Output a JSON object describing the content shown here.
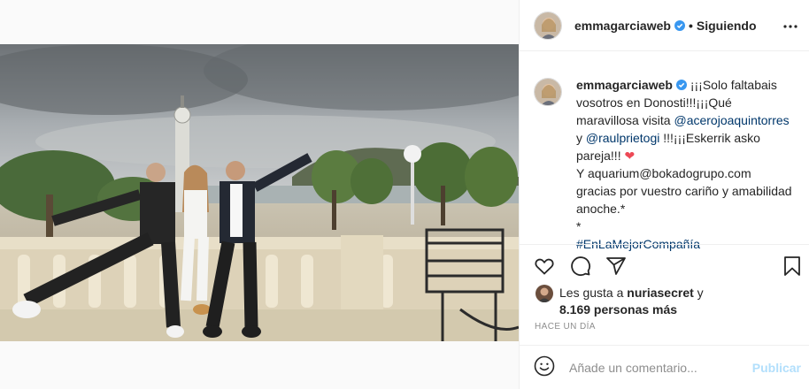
{
  "post": {
    "username": "emmagarciaweb",
    "separator": "•",
    "follow_status": "Siguiendo"
  },
  "caption": {
    "username": "emmagarciaweb",
    "part1": " ¡¡¡Solo faltabais vosotros en Donosti!!!¡¡¡Qué maravillosa visita ",
    "mention1": "@acerojoaquintorres",
    "part2": " y ",
    "mention2": "@raulprietogi",
    "part3": " !!!¡¡¡Eskerrik asko pareja!!! ",
    "part4": "Y aquarium@bokadogrupo.com gracias por vuestro cariño y amabilidad anoche.*",
    "part5": "*",
    "hashtag": "#EnLaMejorCompañía"
  },
  "likes": {
    "prefix": "Les gusta a ",
    "user": "nuriasecret",
    "connector": " y",
    "count": "8.169 personas más"
  },
  "timestamp": "Hace un día",
  "comment": {
    "placeholder": "Añade un comentario...",
    "publish_label": "Publicar"
  },
  "icons": {
    "verified": "verified-badge-icon",
    "more": "more-options-icon",
    "like": "heart-outline-icon",
    "comment": "comment-bubble-icon",
    "share": "paper-plane-icon",
    "save": "bookmark-icon",
    "emoji": "smiley-icon",
    "caption_emoji": "red-heart-emoji"
  },
  "colors": {
    "link": "#00376b",
    "verified": "#3897f0",
    "publish_disabled": "#b2dffc",
    "muted": "#8e8e8e",
    "heart_emoji": "#ed4956"
  }
}
